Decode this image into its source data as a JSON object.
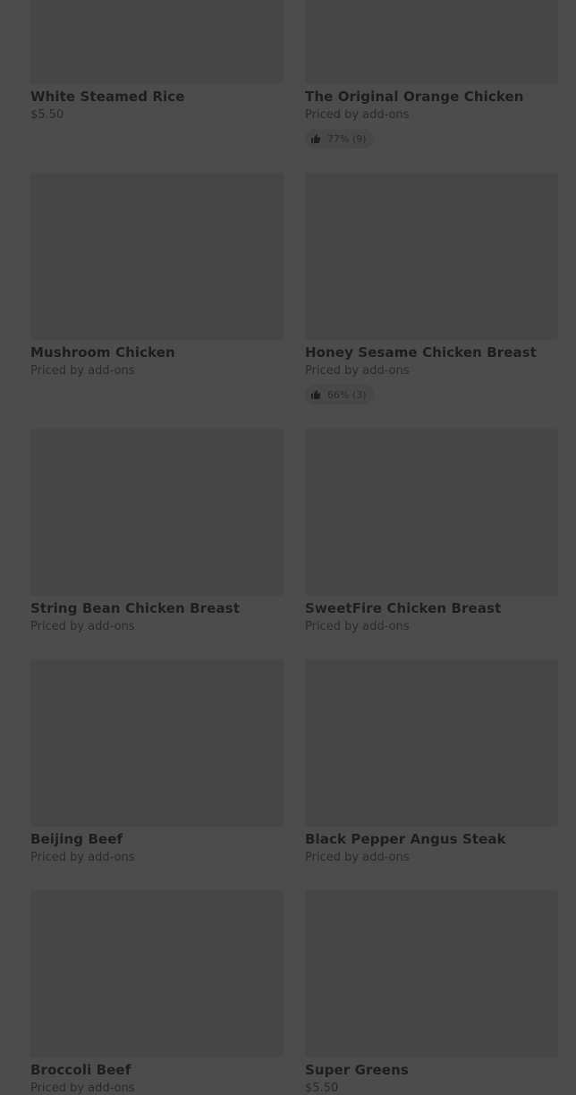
{
  "colors": {
    "overlay_background": "#4c4c4c",
    "card_placeholder": "#474747",
    "text_primary": "#1e1e1e",
    "text_secondary": "#2a2a2a"
  },
  "menu": {
    "items": [
      {
        "title": "White Steamed Rice",
        "price": "$5.50"
      },
      {
        "title": "The Original Orange Chicken",
        "price": "Priced by add-ons",
        "rating": "77% (9)",
        "rating_icon": "thumbs-up-icon"
      },
      {
        "title": "Mushroom Chicken",
        "price": "Priced by add-ons"
      },
      {
        "title": "Honey Sesame Chicken Breast",
        "price": "Priced by add-ons",
        "rating": "66% (3)",
        "rating_icon": "thumbs-up-icon"
      },
      {
        "title": "String Bean Chicken Breast",
        "price": "Priced by add-ons"
      },
      {
        "title": "SweetFire Chicken Breast",
        "price": "Priced by add-ons"
      },
      {
        "title": "Beijing Beef",
        "price": "Priced by add-ons"
      },
      {
        "title": "Black Pepper Angus Steak",
        "price": "Priced by add-ons"
      },
      {
        "title": "Broccoli Beef",
        "price": "Priced by add-ons"
      },
      {
        "title": "Super Greens",
        "price": "$5.50"
      }
    ]
  }
}
